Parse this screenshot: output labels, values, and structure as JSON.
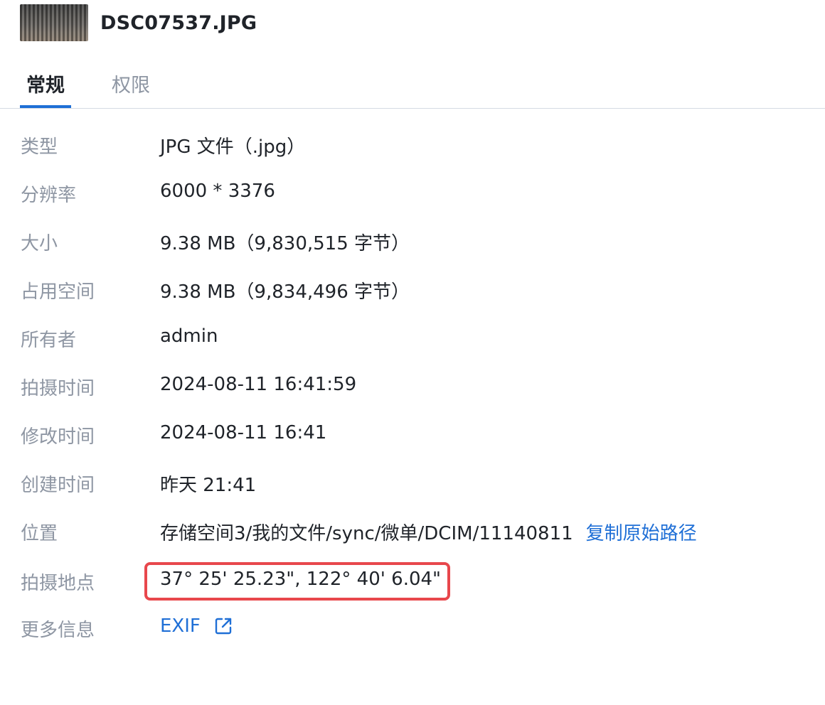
{
  "header": {
    "filename": "DSC07537.JPG",
    "thumbnail_icon": "image-thumbnail"
  },
  "tabs": [
    {
      "label": "常规",
      "active": true
    },
    {
      "label": "权限",
      "active": false
    }
  ],
  "properties": [
    {
      "label": "类型",
      "value": "JPG 文件（.jpg）"
    },
    {
      "label": "分辨率",
      "value": "6000 * 3376"
    },
    {
      "label": "大小",
      "value": "9.38 MB（9,830,515 字节）"
    },
    {
      "label": "占用空间",
      "value": "9.38 MB（9,834,496 字节）"
    },
    {
      "label": "所有者",
      "value": "admin"
    },
    {
      "label": "拍摄时间",
      "value": "2024-08-11 16:41:59"
    },
    {
      "label": "修改时间",
      "value": "2024-08-11 16:41"
    },
    {
      "label": "创建时间",
      "value": "昨天 21:41"
    },
    {
      "label": "位置",
      "value": "存储空间3/我的文件/sync/微单/DCIM/11140811",
      "link": "复制原始路径"
    },
    {
      "label": "拍摄地点",
      "value": "37° 25' 25.23\", 122° 40' 6.04\""
    },
    {
      "label": "更多信息",
      "link": "EXIF",
      "icon": "external-link-icon"
    }
  ],
  "colors": {
    "accent": "#1f6fd6",
    "label": "#8e96a3",
    "text": "#1f2329",
    "highlight_box": "#e8474c",
    "divider": "#d5dbe3"
  }
}
